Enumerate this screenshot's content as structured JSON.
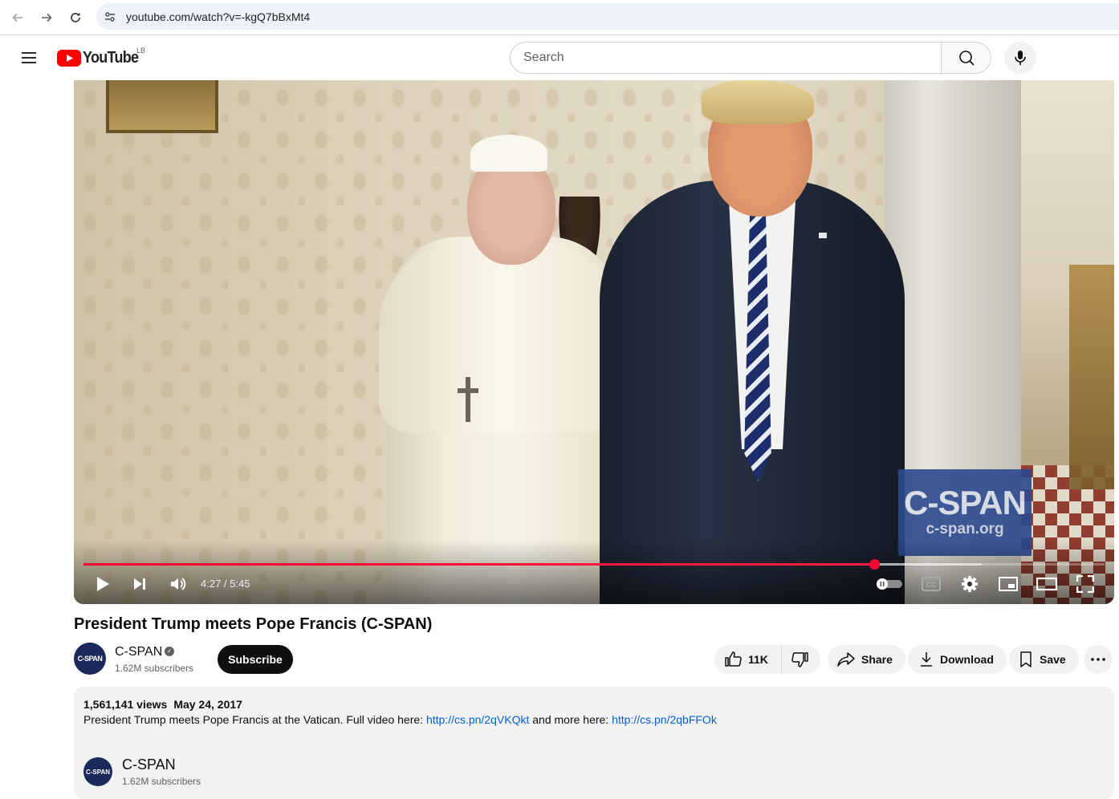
{
  "browser": {
    "url": "youtube.com/watch?v=-kgQ7bBxMt4"
  },
  "header": {
    "logo_text": "YouTube",
    "country_code": "LB",
    "search_placeholder": "Search"
  },
  "player": {
    "current_time": "4:27",
    "duration": "5:45",
    "time_display": "4:27 / 5:45",
    "progress_fraction": 0.774,
    "buffer_fraction": 0.88,
    "watermark_main": "C-SPAN",
    "watermark_sub": "c-span.org",
    "accent_color": "#ff0033",
    "controls": {
      "play": "play-icon",
      "next": "next-icon",
      "volume": "volume-icon",
      "autoplay": "autoplay-toggle",
      "captions": "cc-icon",
      "settings": "gear-icon",
      "miniplayer": "miniplayer-icon",
      "theater": "theater-icon",
      "fullscreen": "fullscreen-icon"
    }
  },
  "video": {
    "title": "President Trump meets Pope Francis (C-SPAN)",
    "channel": {
      "name": "C-SPAN",
      "avatar_text": "C-SPAN",
      "subscribers": "1.62M subscribers",
      "verified": true
    },
    "subscribe_label": "Subscribe",
    "actions": {
      "likes": "11K",
      "share": "Share",
      "download": "Download",
      "save": "Save"
    }
  },
  "description": {
    "views": "1,561,141 views",
    "date": "May 24, 2017",
    "text_before": "President Trump meets Pope Francis at the Vatican. Full video here: ",
    "link1": "http://cs.pn/2qVKQkt",
    "text_middle": " and more here: ",
    "link2": "http://cs.pn/2qbFFOk",
    "channel_name": "C-SPAN",
    "channel_subscribers": "1.62M subscribers"
  }
}
